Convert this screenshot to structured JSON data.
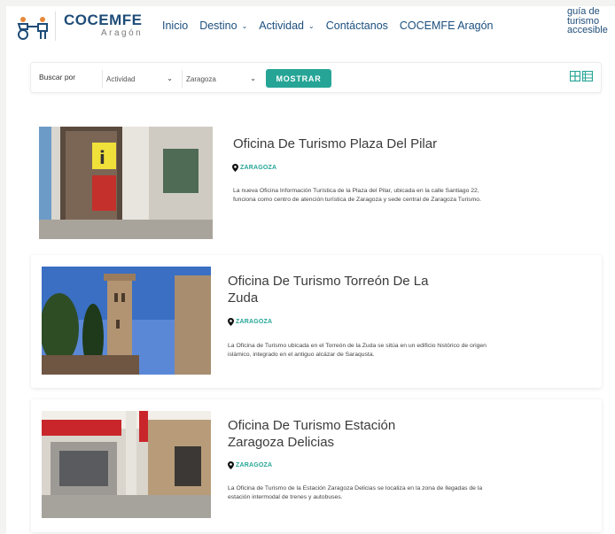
{
  "header": {
    "logo_main": "COCEMFE",
    "logo_sub": "Aragón",
    "nav": [
      {
        "label": "Inicio",
        "dropdown": false
      },
      {
        "label": "Destino",
        "dropdown": true
      },
      {
        "label": "Actividad",
        "dropdown": true
      },
      {
        "label": "Contáctanos",
        "dropdown": false
      },
      {
        "label": "COCEMFE Aragón",
        "dropdown": false
      }
    ],
    "guia_lines": [
      "guía de",
      "turismo",
      "accesible"
    ]
  },
  "search": {
    "label": "Buscar por",
    "activity_value": "Actividad",
    "location_value": "Zaragoza",
    "button_label": "MOSTRAR"
  },
  "colors": {
    "accent": "#26a596",
    "brand": "#1e4c78"
  },
  "cards": [
    {
      "title": "Oficina De Turismo Plaza Del Pilar",
      "location": "ZARAGOZA",
      "description": "La nueva Oficina Información Turística de la Plaza del Pilar, ubicada en la calle Santiago 22, funciona como centro de atención turística de Zaragoza y sede central de Zaragoza Turismo."
    },
    {
      "title": "Oficina De Turismo Torreón De La Zuda",
      "location": "ZARAGOZA",
      "description": "La Oficina de Turismo ubicada en el Torreón de la Zuda se sitúa en un edificio histórico de origen islámico, integrado en el antiguo alcázar de Saraqusta."
    },
    {
      "title": "Oficina De Turismo Estación Zaragoza Delicias",
      "location": "ZARAGOZA",
      "description": "La Oficina de Turismo de la Estación Zaragoza Delicias se localiza en la zona de llegadas de la estación intermodal de trenes y autobuses."
    }
  ]
}
